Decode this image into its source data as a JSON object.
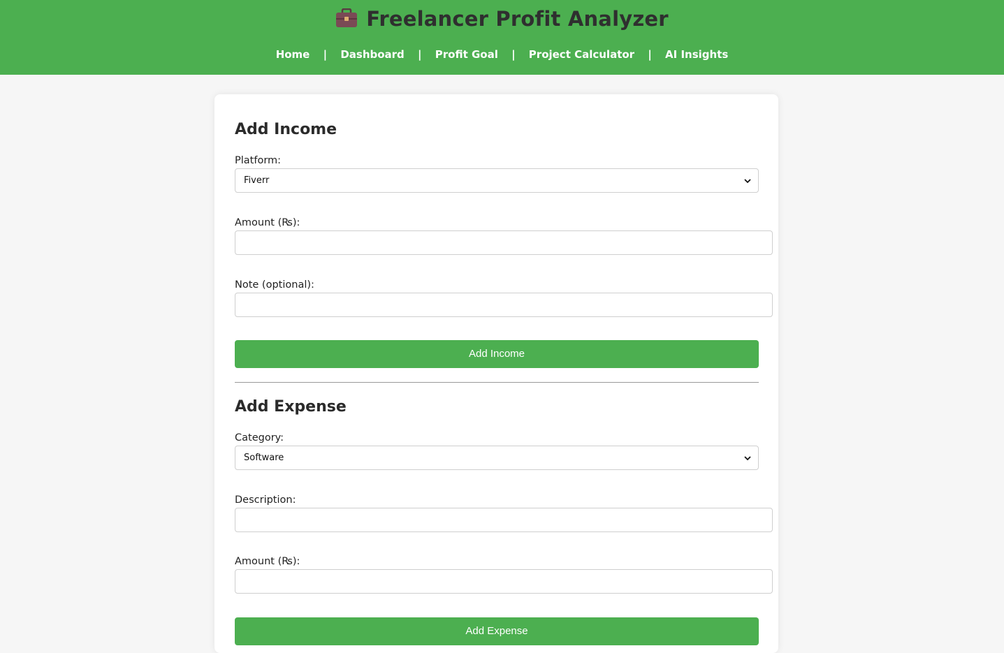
{
  "header": {
    "title": "Freelancer Profit Analyzer",
    "icon": "briefcase-icon",
    "bg_color": "#4caf50"
  },
  "nav": {
    "items": [
      "Home",
      "Dashboard",
      "Profit Goal",
      "Project Calculator",
      "AI Insights"
    ],
    "separator": "|"
  },
  "income": {
    "title": "Add Income",
    "platform_label": "Platform:",
    "platform_value": "Fiverr",
    "amount_label": "Amount (₨):",
    "amount_value": "",
    "note_label": "Note (optional):",
    "note_value": "",
    "button": "Add Income"
  },
  "expense": {
    "title": "Add Expense",
    "category_label": "Category:",
    "category_value": "Software",
    "description_label": "Description:",
    "description_value": "",
    "amount_label": "Amount (₨):",
    "amount_value": "",
    "button": "Add Expense"
  },
  "colors": {
    "accent": "#4caf50",
    "page_bg": "#f6f6f6",
    "card_bg": "#ffffff"
  }
}
